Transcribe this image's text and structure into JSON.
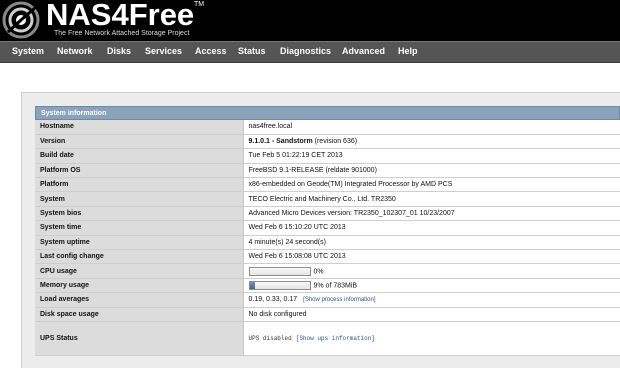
{
  "header": {
    "logo_text": "NAS4Free",
    "logo_tm": "TM",
    "tagline": "The Free Network Attached Storage Project"
  },
  "nav": {
    "items": [
      "System",
      "Network",
      "Disks",
      "Services",
      "Access",
      "Status",
      "Diagnostics",
      "Advanced",
      "Help"
    ]
  },
  "panel": {
    "title": "System information"
  },
  "sysinfo": {
    "hostname": {
      "label": "Hostname",
      "value": "nas4free.local"
    },
    "version": {
      "label": "Version",
      "value_bold": "9.1.0.1 - Sandstorm",
      "value_rest": " (revision 636)"
    },
    "build_date": {
      "label": "Build date",
      "value": "Tue Feb 5 01:22:19 CET 2013"
    },
    "platform_os": {
      "label": "Platform OS",
      "value": "FreeBSD 9.1-RELEASE (reldate 901000)"
    },
    "platform": {
      "label": "Platform",
      "value": "x86-embedded on Geode(TM) Integrated Processor by AMD PCS"
    },
    "system": {
      "label": "System",
      "value": "TECO Electric and Machinery Co., Ltd. TR2350"
    },
    "system_bios": {
      "label": "System bios",
      "value": "Advanced Micro Devices version: TR2350_102307_01 10/23/2007"
    },
    "system_time": {
      "label": "System time",
      "value": "Wed Feb  6 15:10:20 UTC 2013"
    },
    "system_uptime": {
      "label": "System uptime",
      "value": "4 minute(s) 24 second(s)"
    },
    "last_config_change": {
      "label": "Last config change",
      "value": "Wed Feb 6 15:08:08 UTC 2013"
    },
    "cpu_usage": {
      "label": "CPU usage",
      "percent": 0,
      "value": "0%"
    },
    "memory_usage": {
      "label": "Memory usage",
      "percent": 9,
      "value": "9% of 783MiB"
    },
    "load_averages": {
      "label": "Load averages",
      "value": "0.19, 0.33, 0.17",
      "link": "[Show process information]"
    },
    "disk_space_usage": {
      "label": "Disk space usage",
      "value": "No disk configured"
    },
    "ups_status": {
      "label": "UPS Status",
      "value": "UPS disabled",
      "link": "[Show ups information]"
    }
  },
  "colors": {
    "header_bg": "#000000",
    "nav_bg": "#555555",
    "panel_title_bg": "#8aa3bb",
    "label_cell_bg": "#dcdcdc",
    "link": "#2c4f9e"
  }
}
